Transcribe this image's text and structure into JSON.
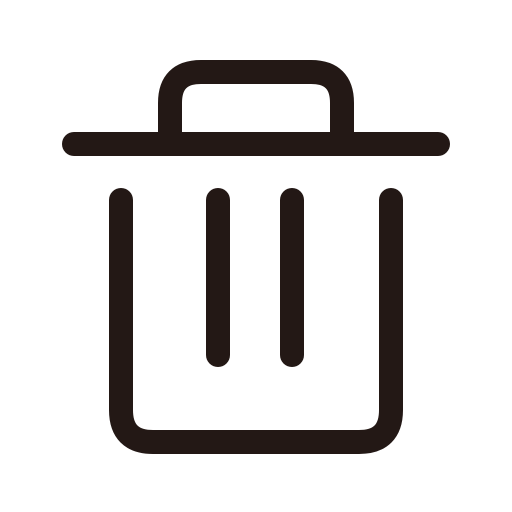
{
  "icon": {
    "name": "trash-icon",
    "stroke_color": "#231815",
    "background_color": "#ffffff"
  }
}
